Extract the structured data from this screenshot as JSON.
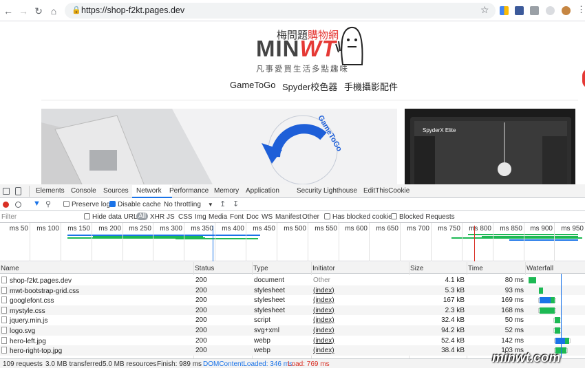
{
  "browser": {
    "url": "https://shop-f2kt.pages.dev"
  },
  "page": {
    "logo_top_plain": "梅問題",
    "logo_top_red": "購物網",
    "logo_main_plain": "MIN",
    "logo_main_red": "WT",
    "logo_sub": "凡事愛買生活多點趣味",
    "nav": [
      "GameToGo",
      "Spyder校色器",
      "手機攝影配件"
    ],
    "hero_text": "GameToGo",
    "hero2_title": "SpyderX Elite"
  },
  "devtools": {
    "tabs": [
      "Elements",
      "Console",
      "Sources",
      "Network",
      "Performance",
      "Memory",
      "Application",
      "Security",
      "Lighthouse",
      "EditThisCookie"
    ],
    "active_tab": "Network",
    "toolbar": {
      "preserve_log": "Preserve log",
      "disable_cache": "Disable cache",
      "throttling": "No throttling"
    },
    "filter": {
      "placeholder": "Filter",
      "hide_data_urls": "Hide data URLs",
      "types": [
        "All",
        "XHR",
        "JS",
        "CSS",
        "Img",
        "Media",
        "Font",
        "Doc",
        "WS",
        "Manifest",
        "Other"
      ],
      "has_blocked_cookies": "Has blocked cookies",
      "blocked_requests": "Blocked Requests"
    },
    "timeline_ticks": [
      "50 ms",
      "100 ms",
      "150 ms",
      "200 ms",
      "250 ms",
      "300 ms",
      "350 ms",
      "400 ms",
      "450 ms",
      "500 ms",
      "550 ms",
      "600 ms",
      "650 ms",
      "700 ms",
      "750 ms",
      "800 ms",
      "850 ms",
      "900 ms",
      "950 ms"
    ],
    "columns": [
      "Name",
      "Status",
      "Type",
      "Initiator",
      "Size",
      "Time",
      "Waterfall"
    ],
    "rows": [
      {
        "name": "shop-f2kt.pages.dev",
        "status": "200",
        "type": "document",
        "initiator": "Other",
        "size": "4.1 kB",
        "time": "80 ms"
      },
      {
        "name": "mwt-bootstrap-grid.css",
        "status": "200",
        "type": "stylesheet",
        "initiator": "(index)",
        "size": "5.3 kB",
        "time": "93 ms"
      },
      {
        "name": "googlefont.css",
        "status": "200",
        "type": "stylesheet",
        "initiator": "(index)",
        "size": "167 kB",
        "time": "169 ms"
      },
      {
        "name": "mystyle.css",
        "status": "200",
        "type": "stylesheet",
        "initiator": "(index)",
        "size": "2.3 kB",
        "time": "168 ms"
      },
      {
        "name": "jquery.min.js",
        "status": "200",
        "type": "script",
        "initiator": "(index)",
        "size": "32.4 kB",
        "time": "50 ms"
      },
      {
        "name": "logo.svg",
        "status": "200",
        "type": "svg+xml",
        "initiator": "(index)",
        "size": "94.2 kB",
        "time": "52 ms"
      },
      {
        "name": "hero-left.jpg",
        "status": "200",
        "type": "webp",
        "initiator": "(index)",
        "size": "52.4 kB",
        "time": "142 ms"
      },
      {
        "name": "hero-right-top.jpg",
        "status": "200",
        "type": "webp",
        "initiator": "(index)",
        "size": "38.4 kB",
        "time": "103 ms"
      }
    ],
    "status": {
      "requests": "109 requests",
      "transferred": "3.0 MB transferred",
      "resources": "5.0 MB resources",
      "finish": "Finish: 989 ms",
      "dcl": "DOMContentLoaded: 346 ms",
      "load": "Load: 769 ms"
    }
  },
  "watermark": "minwt.com",
  "colors": {
    "accent": "#1a73e8",
    "brand_red": "#e53935",
    "dcl_blue": "#1a73e8",
    "load_red": "#d93025",
    "waterfall_green": "#1db954"
  }
}
